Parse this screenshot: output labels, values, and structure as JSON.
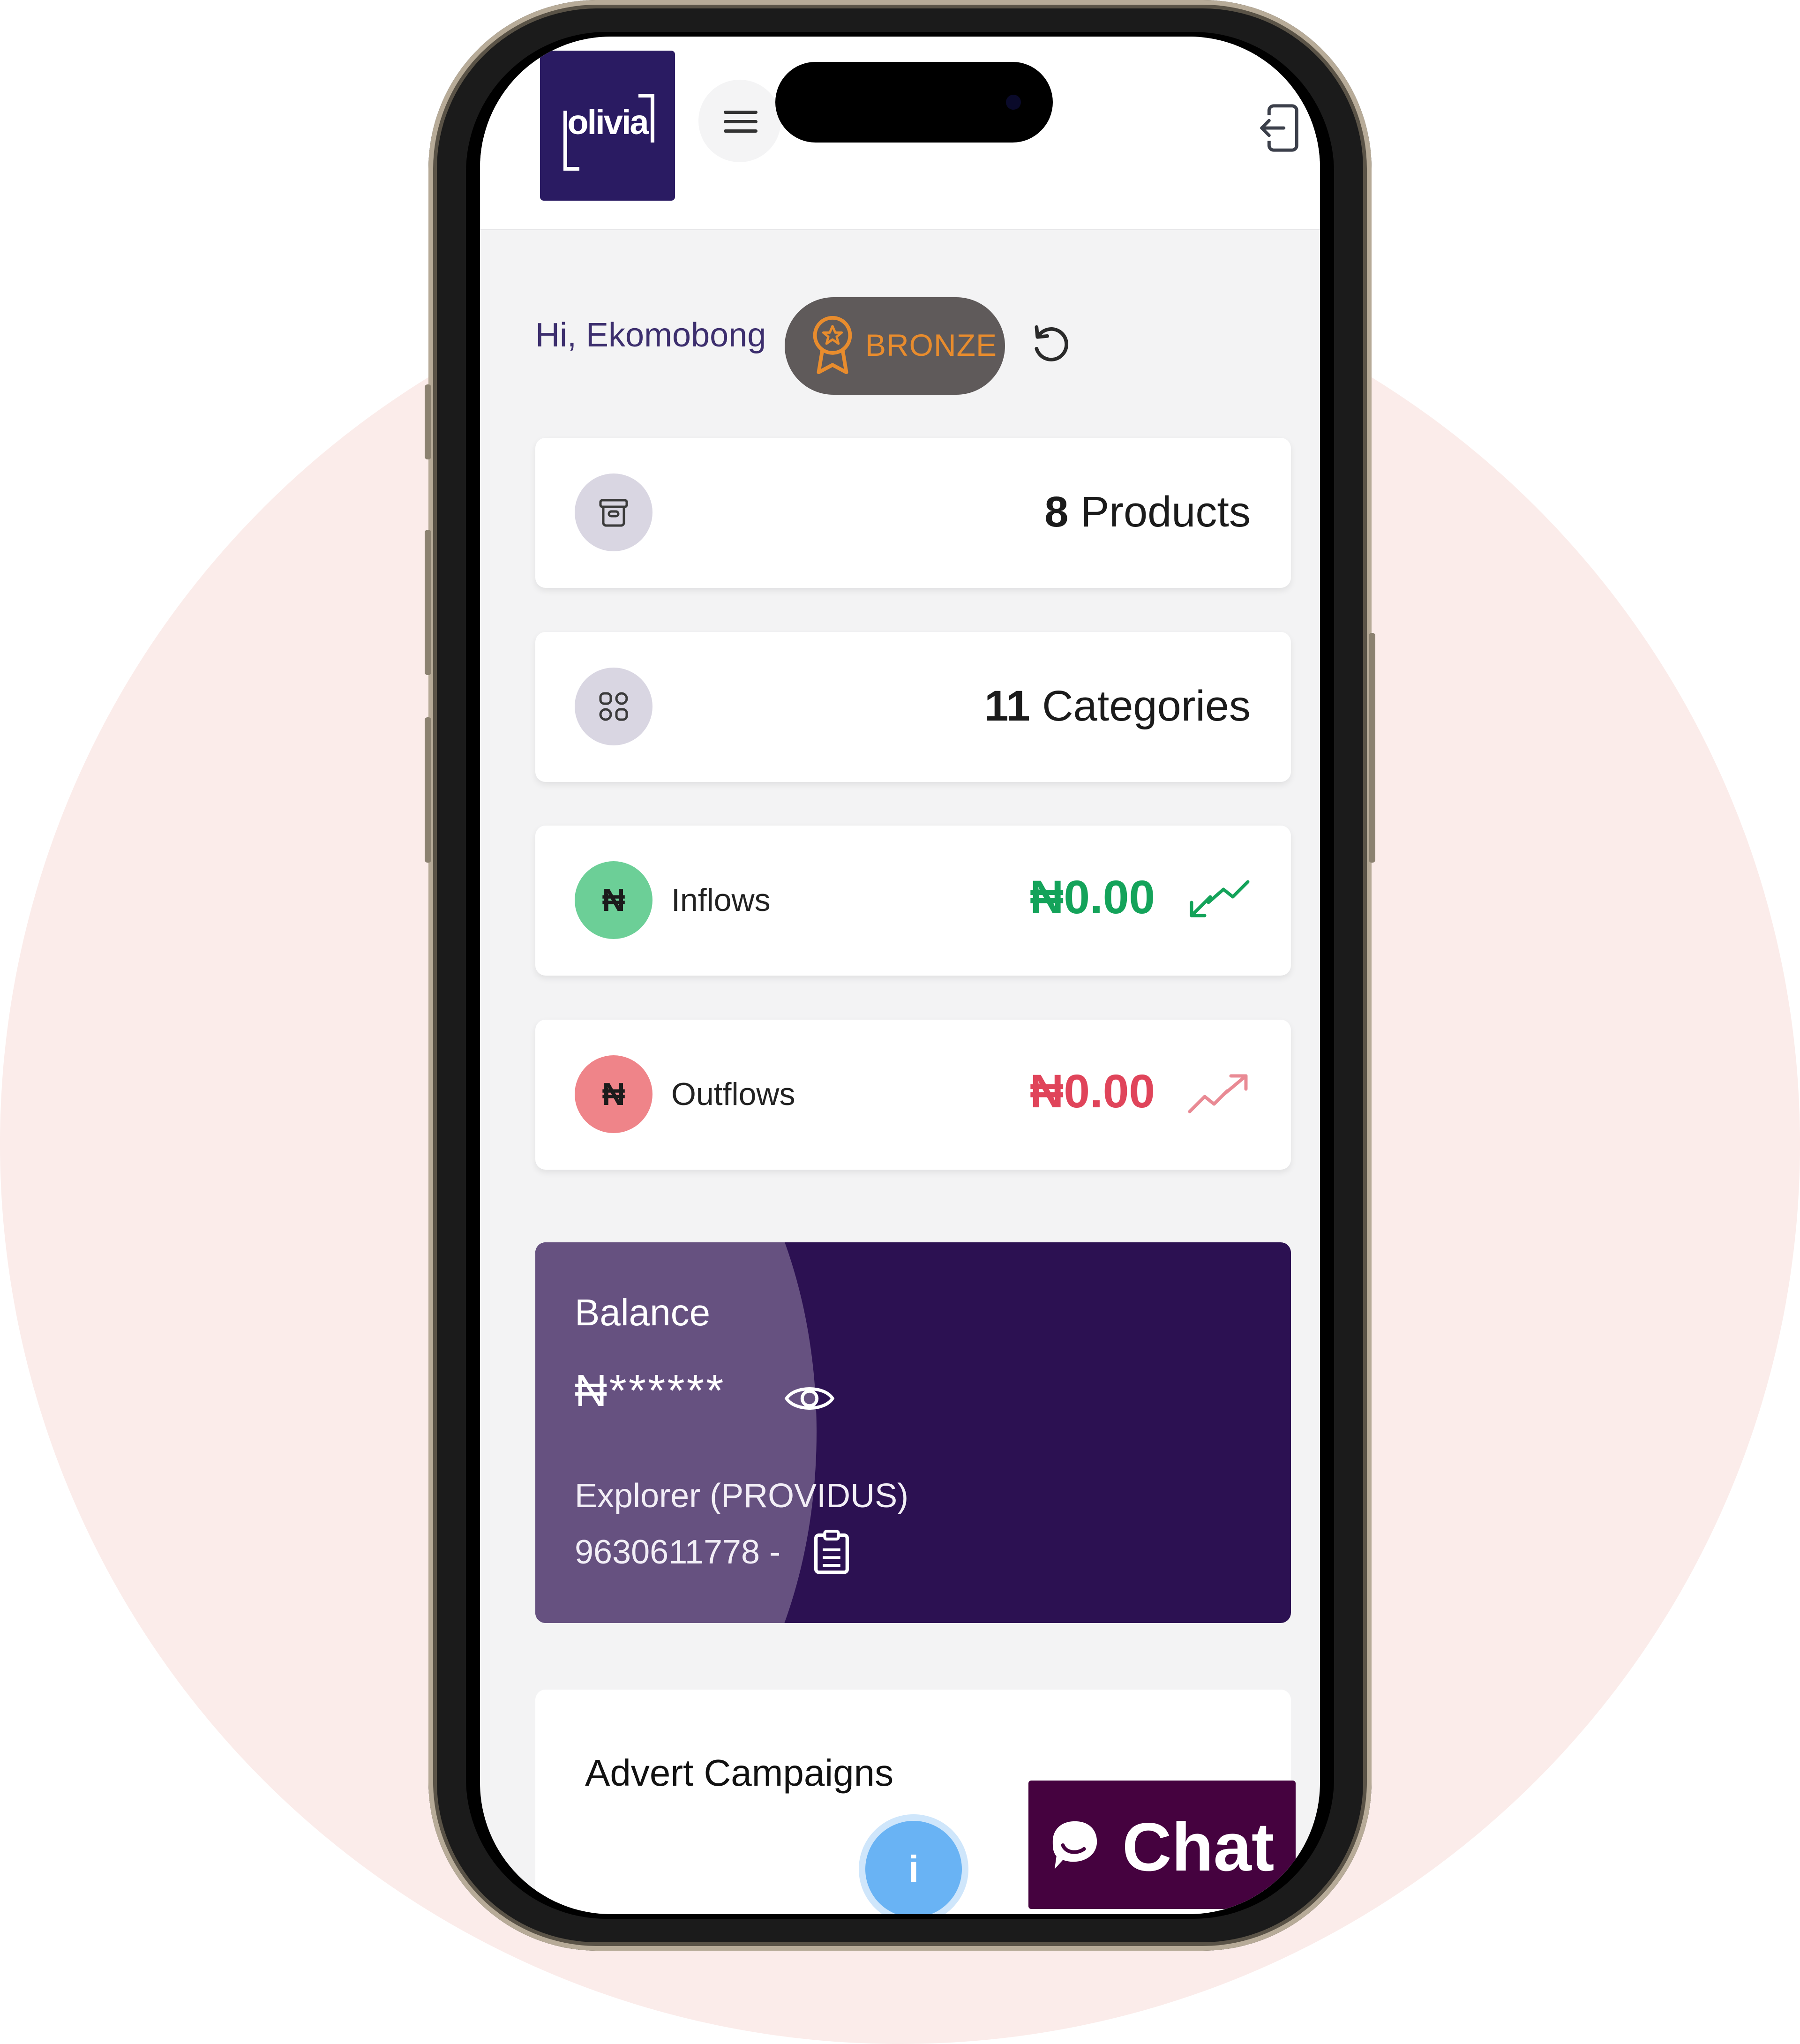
{
  "logo": {
    "text": "olivia"
  },
  "greeting": {
    "text": "Hi, Ekomobong"
  },
  "tier_badge": {
    "label": "BRONZE",
    "color": "#e88c2d"
  },
  "stats": {
    "products": {
      "count": "8",
      "label": "Products",
      "icon": "package-icon"
    },
    "categories": {
      "count": "11",
      "label": "Categories",
      "icon": "grid-icon"
    },
    "inflows": {
      "label": "Inflows",
      "amount": "₦0.00",
      "color": "#14a35a",
      "icon_symbol": "₦"
    },
    "outflows": {
      "label": "Outflows",
      "amount": "₦0.00",
      "color": "#e0445a",
      "icon_symbol": "₦"
    }
  },
  "balance": {
    "title": "Balance",
    "amount_masked": "₦******",
    "bank": "Explorer (PROVIDUS)",
    "account": "9630611778 -"
  },
  "advert": {
    "title": "Advert Campaigns"
  },
  "info_button": {
    "label": "i"
  },
  "chat_button": {
    "label": "Chat"
  },
  "colors": {
    "brand": "#2a1b62",
    "balance_dark": "#2c1152",
    "balance_light": "#665180",
    "chat": "#45023f",
    "info": "#69b3f4"
  }
}
